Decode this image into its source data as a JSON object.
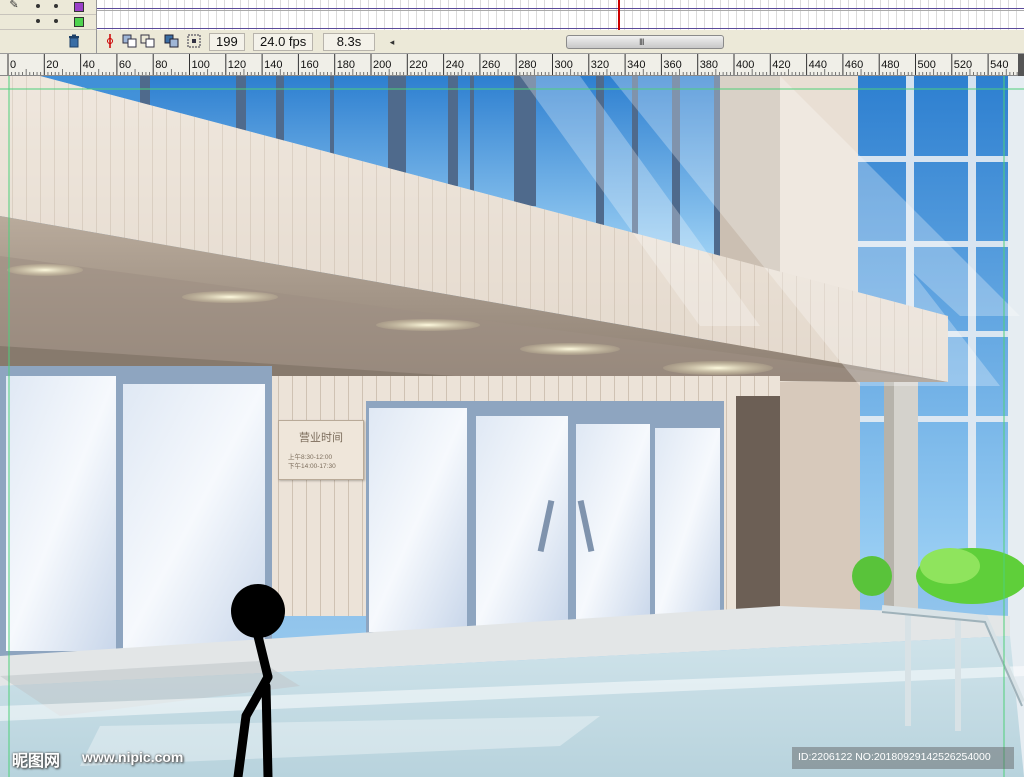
{
  "timeline": {
    "layers": [
      {
        "color": "#9a3fc8"
      },
      {
        "color": "#4fd34f"
      }
    ],
    "frame_number": "199",
    "frame_rate": "24.0 fps",
    "elapsed_time": "8.3s",
    "scroll_grip": "III"
  },
  "ruler": {
    "ticks": [
      "0",
      "20",
      "40",
      "60",
      "80",
      "100",
      "120",
      "140",
      "160",
      "180",
      "200",
      "220",
      "240",
      "260",
      "280",
      "300",
      "320",
      "340",
      "360",
      "380",
      "400",
      "420",
      "440",
      "460",
      "480",
      "500",
      "520",
      "540"
    ]
  },
  "stage": {
    "sign": {
      "title": "营业时间",
      "morning": "上午8:30-12:00",
      "afternoon": "下午14:00-17:30"
    },
    "watermark": {
      "brand": "昵图网",
      "url": "www.nipic.com",
      "image_id": "ID:2206122 NO:20180929142526254000"
    }
  }
}
